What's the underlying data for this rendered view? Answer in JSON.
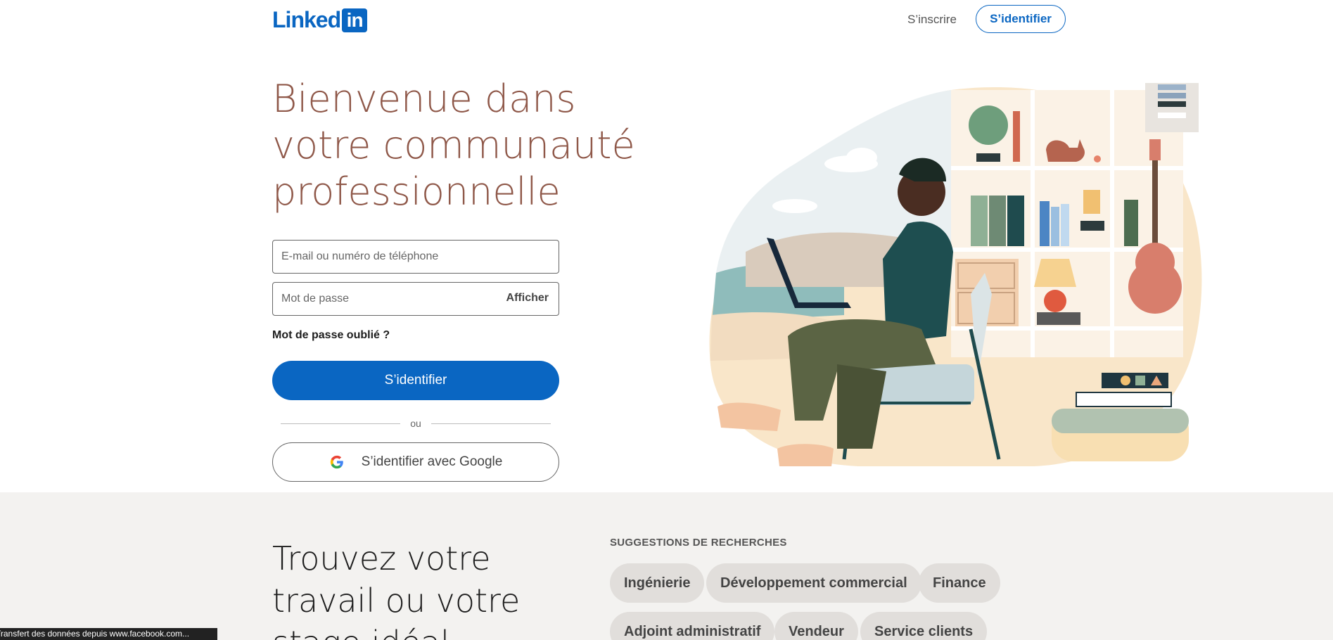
{
  "header": {
    "logo_text": "Linked",
    "logo_in": "in",
    "join_label": "S’inscrire",
    "signin_label": "S’identifier"
  },
  "hero": {
    "title": "Bienvenue dans votre communauté professionnelle",
    "email_placeholder": "E-mail ou numéro de téléphone",
    "password_placeholder": "Mot de passe",
    "show_label": "Afficher",
    "forgot_label": "Mot de passe oublié ?",
    "signin_label": "S’identifier",
    "or_label": "ou",
    "google_label": "S’identifier avec Google"
  },
  "jobs": {
    "title": "Trouvez votre travail ou votre stage idéal",
    "suggestions_heading": "SUGGESTIONS DE RECHERCHES",
    "suggestions": [
      "Ingénierie",
      "Développement commercial",
      "Finance",
      "Adjoint administratif",
      "Vendeur",
      "Service clients"
    ]
  },
  "status_bar": "Transfert des données depuis www.facebook.com...",
  "colors": {
    "brand_blue": "#0a66c2",
    "hero_title": "#8f5849",
    "band_bg": "#f3f2f0",
    "pill_bg": "#e1dedb"
  },
  "icons": [
    "google-icon",
    "person-with-laptop-illustration"
  ]
}
